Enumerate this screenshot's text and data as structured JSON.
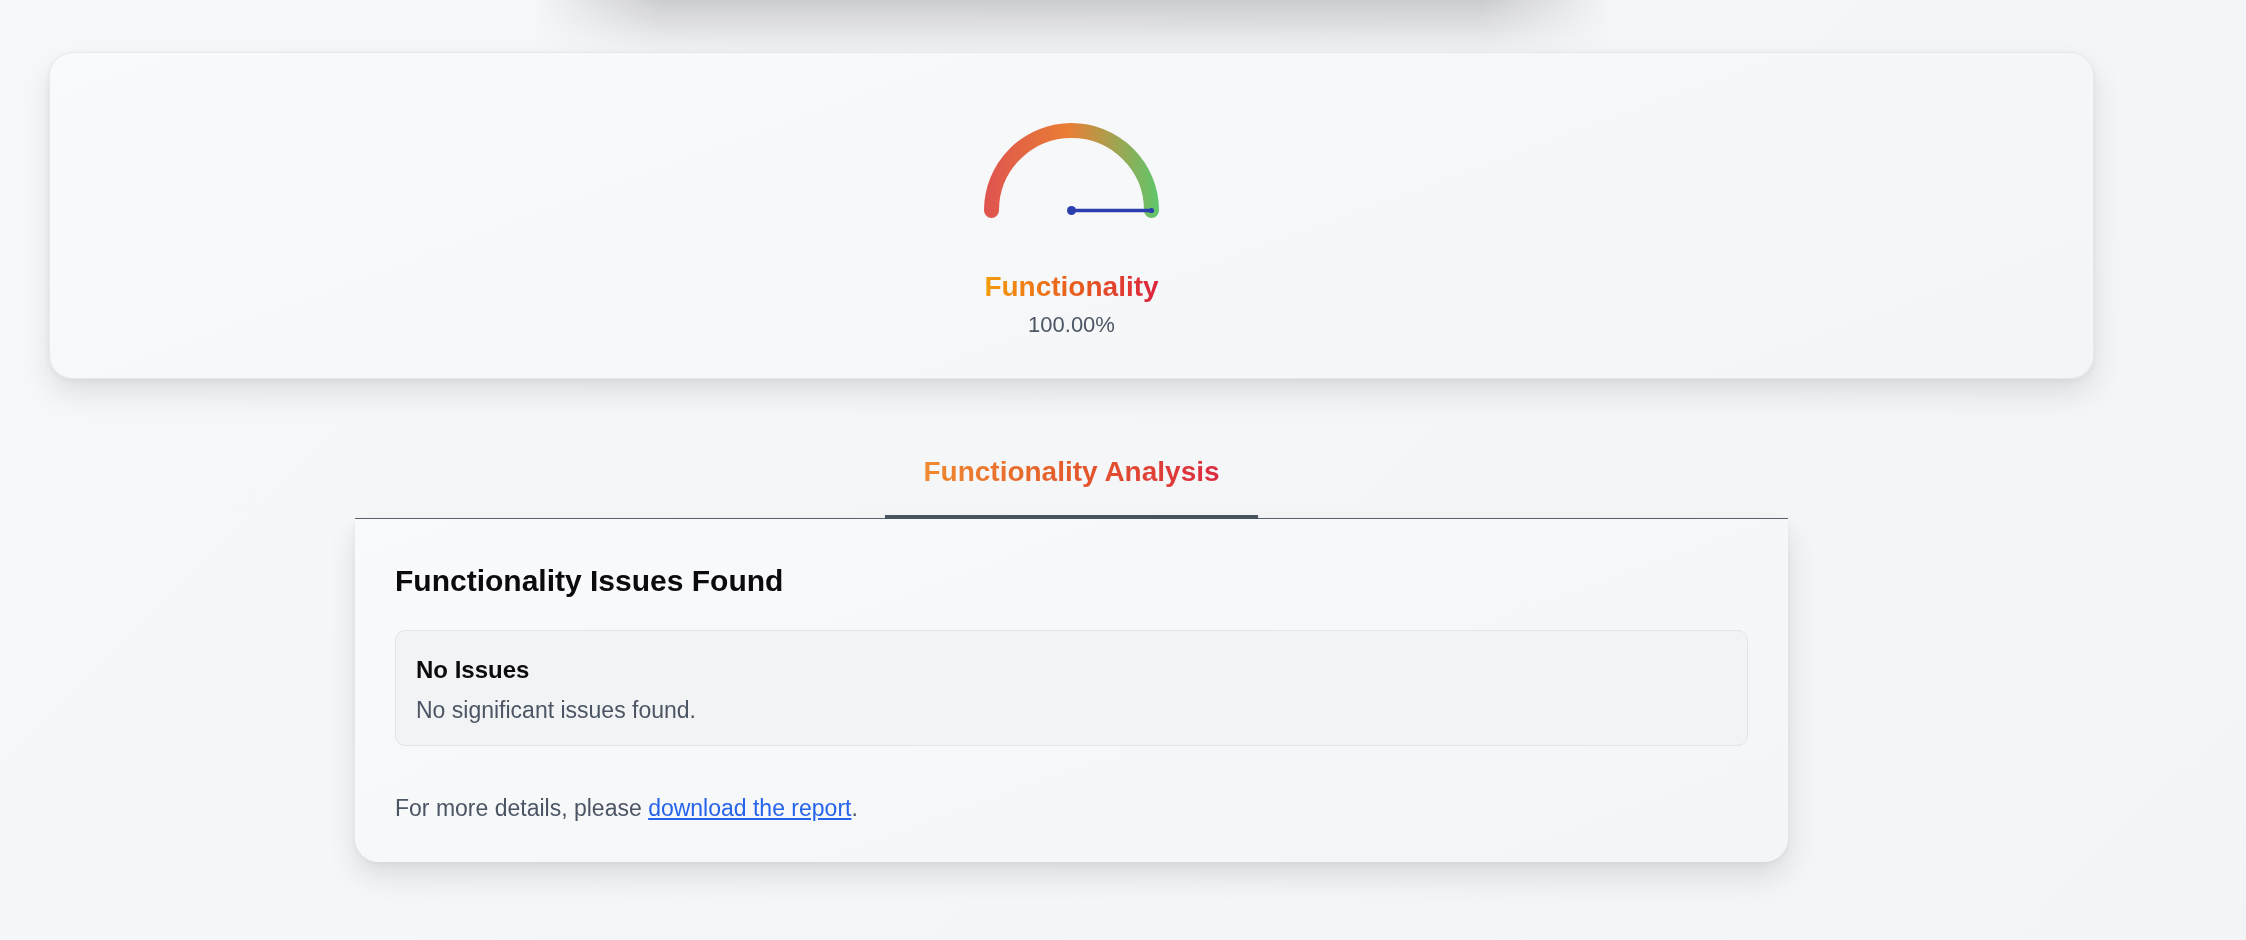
{
  "gauge_card": {
    "gauge": {
      "level": 1
    },
    "title": "Functionality",
    "value": "100.00%"
  },
  "tabs": [
    {
      "label": "Functionality Analysis",
      "selected": true
    }
  ],
  "panel": {
    "heading": "Functionality Issues Found",
    "issues": [
      {
        "title": "No Issues",
        "description": "No significant issues found."
      }
    ],
    "footer": {
      "lead": "For more details, please ",
      "link": "download the report",
      "tail": "."
    }
  }
}
